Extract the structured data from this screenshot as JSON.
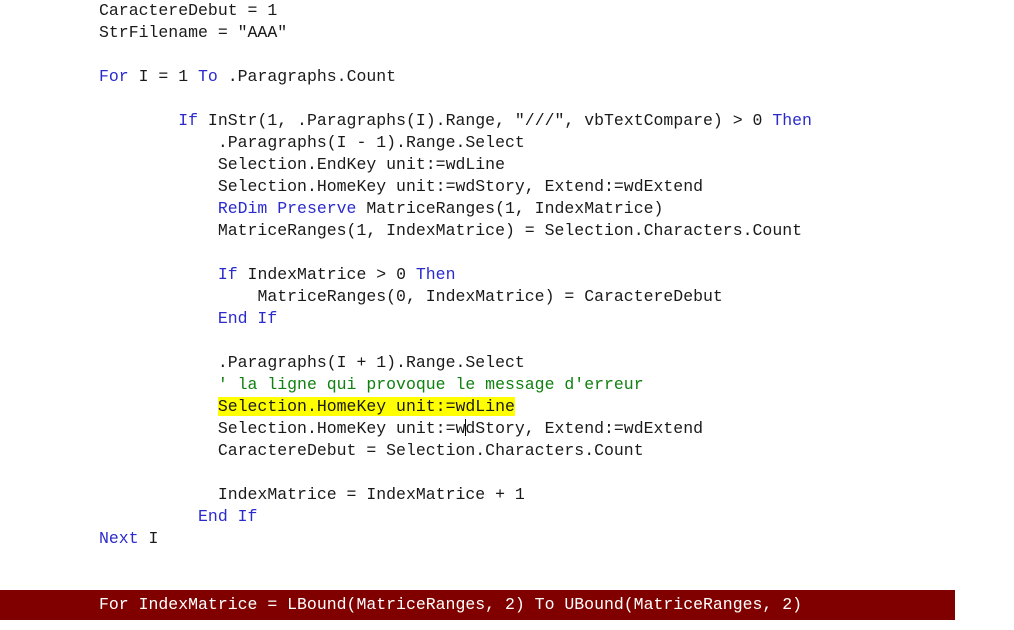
{
  "editor": {
    "language": "VBA",
    "background_color": "#ffffff",
    "text_color": "#1a1a1a",
    "keyword_color": "#2b2bcc",
    "comment_color": "#108010",
    "highlight_color": "#ffff00",
    "lines": [
      {
        "id": 1,
        "indent": 0,
        "segments": [
          {
            "t": "CaractereDebut = 1",
            "k": "plain"
          }
        ]
      },
      {
        "id": 2,
        "indent": 0,
        "segments": [
          {
            "t": "StrFilename = ",
            "k": "plain"
          },
          {
            "t": "\"AAA\"",
            "k": "str"
          }
        ]
      },
      {
        "id": 3,
        "indent": 0,
        "segments": [
          {
            "t": "",
            "k": "plain"
          }
        ]
      },
      {
        "id": 4,
        "indent": 0,
        "segments": [
          {
            "t": "For",
            "k": "kw"
          },
          {
            "t": " I = 1 ",
            "k": "plain"
          },
          {
            "t": "To",
            "k": "kw"
          },
          {
            "t": " .Paragraphs.Count",
            "k": "plain"
          }
        ]
      },
      {
        "id": 5,
        "indent": 0,
        "segments": [
          {
            "t": "",
            "k": "plain"
          }
        ]
      },
      {
        "id": 6,
        "indent": 4,
        "segments": [
          {
            "t": "If",
            "k": "kw"
          },
          {
            "t": " InStr(1, .Paragraphs(I).Range, ",
            "k": "plain"
          },
          {
            "t": "\"///\"",
            "k": "str"
          },
          {
            "t": ", vbTextCompare) > 0 ",
            "k": "plain"
          },
          {
            "t": "Then",
            "k": "kw"
          }
        ]
      },
      {
        "id": 7,
        "indent": 6,
        "segments": [
          {
            "t": ".Paragraphs(I - 1).Range.Select",
            "k": "plain"
          }
        ]
      },
      {
        "id": 8,
        "indent": 6,
        "segments": [
          {
            "t": "Selection.EndKey unit:=wdLine",
            "k": "plain"
          }
        ]
      },
      {
        "id": 9,
        "indent": 6,
        "segments": [
          {
            "t": "Selection.HomeKey unit:=wdStory, Extend:=wdExtend",
            "k": "plain"
          }
        ]
      },
      {
        "id": 10,
        "indent": 6,
        "segments": [
          {
            "t": "ReDim Preserve",
            "k": "kw"
          },
          {
            "t": " MatriceRanges(1, IndexMatrice)",
            "k": "plain"
          }
        ]
      },
      {
        "id": 11,
        "indent": 6,
        "segments": [
          {
            "t": "MatriceRanges(1, IndexMatrice) = Selection.Characters.Count",
            "k": "plain"
          }
        ]
      },
      {
        "id": 12,
        "indent": 0,
        "segments": [
          {
            "t": "",
            "k": "plain"
          }
        ]
      },
      {
        "id": 13,
        "indent": 6,
        "segments": [
          {
            "t": "If",
            "k": "kw"
          },
          {
            "t": " IndexMatrice > 0 ",
            "k": "plain"
          },
          {
            "t": "Then",
            "k": "kw"
          }
        ]
      },
      {
        "id": 14,
        "indent": 8,
        "segments": [
          {
            "t": "MatriceRanges(0, IndexMatrice) = CaractereDebut",
            "k": "plain"
          }
        ]
      },
      {
        "id": 15,
        "indent": 6,
        "segments": [
          {
            "t": "End If",
            "k": "kw"
          }
        ]
      },
      {
        "id": 16,
        "indent": 0,
        "segments": [
          {
            "t": "",
            "k": "plain"
          }
        ]
      },
      {
        "id": 17,
        "indent": 6,
        "segments": [
          {
            "t": ".Paragraphs(I + 1).Range.Select",
            "k": "plain"
          }
        ]
      },
      {
        "id": 18,
        "indent": 6,
        "segments": [
          {
            "t": "' la ligne qui provoque le message d'erreur",
            "k": "comment"
          }
        ]
      },
      {
        "id": 19,
        "indent": 6,
        "segments": [
          {
            "t": "Selection.HomeKey unit:=wdLine",
            "k": "hl"
          }
        ]
      },
      {
        "id": 20,
        "indent": 6,
        "segments": [
          {
            "t": "Selection.HomeKey unit:=w",
            "k": "plain"
          },
          {
            "t": "",
            "k": "caret"
          },
          {
            "t": "dStory, Extend:=wdExtend",
            "k": "plain"
          }
        ]
      },
      {
        "id": 21,
        "indent": 6,
        "segments": [
          {
            "t": "CaractereDebut = Selection.Characters.Count",
            "k": "plain"
          }
        ]
      },
      {
        "id": 22,
        "indent": 0,
        "segments": [
          {
            "t": "",
            "k": "plain"
          }
        ]
      },
      {
        "id": 23,
        "indent": 6,
        "segments": [
          {
            "t": "IndexMatrice = IndexMatrice + 1",
            "k": "plain"
          }
        ]
      },
      {
        "id": 24,
        "indent": 5,
        "segments": [
          {
            "t": "End If",
            "k": "kw"
          }
        ]
      },
      {
        "id": 25,
        "indent": 0,
        "segments": [
          {
            "t": "Next",
            "k": "kw"
          },
          {
            "t": " I",
            "k": "plain"
          }
        ]
      }
    ]
  },
  "status_bar": {
    "background_color": "#800000",
    "text_color": "#ffffff",
    "text": "For IndexMatrice = LBound(MatriceRanges, 2) To UBound(MatriceRanges, 2)"
  }
}
